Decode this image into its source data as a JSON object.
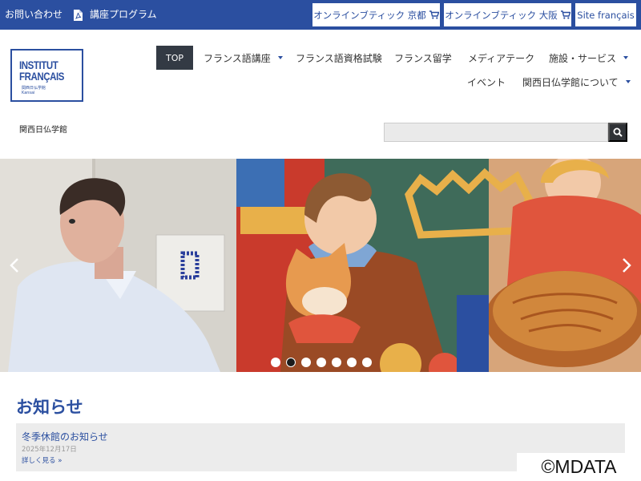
{
  "topbar": {
    "contact": "お問い合わせ",
    "program": "講座プログラム",
    "shop_kyoto": "オンラインブティック 京都",
    "shop_osaka": "オンラインブティック 大阪",
    "site_fr": "Site français"
  },
  "logo": {
    "line1": "INSTITUT",
    "line2": "FRANÇAIS",
    "sub1": "関西日仏学館",
    "sub2": "Kansai"
  },
  "nav": {
    "top": "TOP",
    "courses": "フランス語講座",
    "exams": "フランス語資格試験",
    "study": "フランス留学",
    "mediatheque": "メディアテーク",
    "facilities": "施設・サービス",
    "events": "イベント",
    "about": "関西日仏学館について"
  },
  "subtitle": "関西日仏学館",
  "search": {
    "placeholder": ""
  },
  "carousel": {
    "slides": 7,
    "active_index": 1
  },
  "news": {
    "heading": "お知らせ",
    "items": [
      {
        "title": "冬季休館のお知らせ",
        "date": "2025年12月17日",
        "more": "詳しく見る »"
      }
    ]
  },
  "watermark": "©MDATA",
  "colors": {
    "brand": "#2b4fa0",
    "nav_active": "#333a44",
    "search_btn": "#2f3236",
    "card": "#ececec"
  },
  "icons": [
    "pdf-icon",
    "cart-icon",
    "search-icon",
    "chevron-left-icon",
    "chevron-right-icon",
    "caret-down-icon"
  ]
}
